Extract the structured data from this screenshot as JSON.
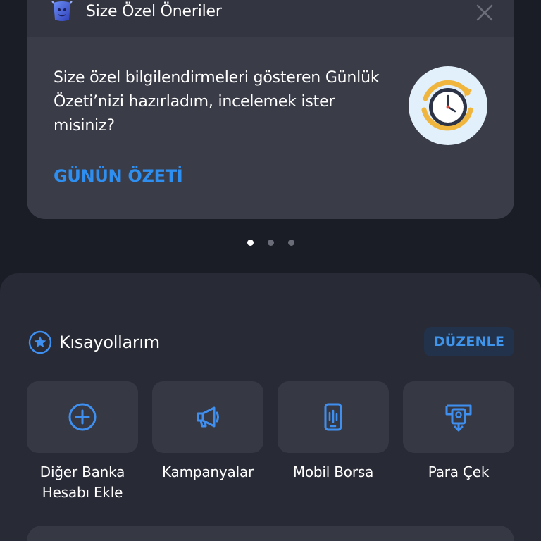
{
  "card": {
    "title": "Size Özel Öneriler",
    "body": "Size özel bilgilendirmeleri gösteren Günlük Özeti’nizi hazırladım, incelemek ister misiniz?",
    "link": "GÜNÜN ÖZETİ",
    "close_icon": "close-icon",
    "logo_icon": "assistant-logo-icon",
    "illustration_icon": "clock-icon"
  },
  "pager": {
    "count": 3,
    "active": 0
  },
  "shortcuts": {
    "title": "Kısayollarım",
    "edit_label": "DÜZENLE",
    "items": [
      {
        "label": "Diğer Banka Hesabı Ekle",
        "icon": "plus-circle-icon"
      },
      {
        "label": "Kampanyalar",
        "icon": "megaphone-icon"
      },
      {
        "label": "Mobil Borsa",
        "icon": "stock-phone-icon"
      },
      {
        "label": "Para Çek",
        "icon": "atm-withdraw-icon"
      }
    ]
  },
  "colors": {
    "background": "#1b1d26",
    "card": "#3a3c48",
    "panel": "#282a35",
    "tile": "#363843",
    "accent": "#2e8ff0"
  }
}
